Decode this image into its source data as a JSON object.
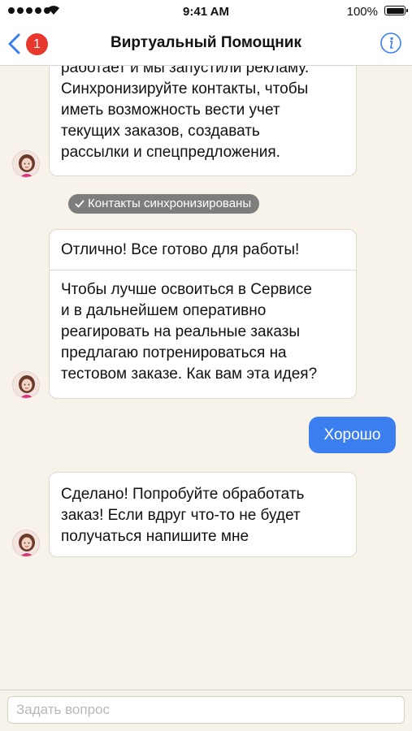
{
  "status_bar": {
    "time": "9:41 AM",
    "battery": "100%",
    "battery_level": 1.0
  },
  "nav": {
    "badge": "1",
    "title": "Виртуальный Помощник",
    "back_icon": "chevron-left-icon",
    "info_icon": "info-icon",
    "accent_color": "#3b7ef0",
    "badge_color": "#e8372c"
  },
  "messages": {
    "m1": {
      "lines": [
        "работает и мы запустили рекламу.",
        "Синхронизируйте контакты, чтобы",
        "иметь возможность вести учет",
        "текущих заказов, создавать",
        "рассылки и спецпредложения."
      ]
    },
    "system": {
      "text": "Контакты синхронизированы"
    },
    "m2": {
      "header": "Отлично! Все готово для работы!",
      "lines": [
        "Чтобы лучше освоиться в Сервисе",
        "и в дальнейшем оперативно",
        "реагировать на реальные заказы",
        "предлагаю потренироваться на",
        "тестовом заказе. Как вам эта идея?"
      ]
    },
    "user": {
      "text": "Хорошо"
    },
    "m3": {
      "lines": [
        "Сделано! Попробуйте обработать",
        "заказ! Если вдруг что-то не будет",
        "получаться напишите мне"
      ]
    }
  },
  "input": {
    "placeholder": "Задать вопрос",
    "value": ""
  }
}
